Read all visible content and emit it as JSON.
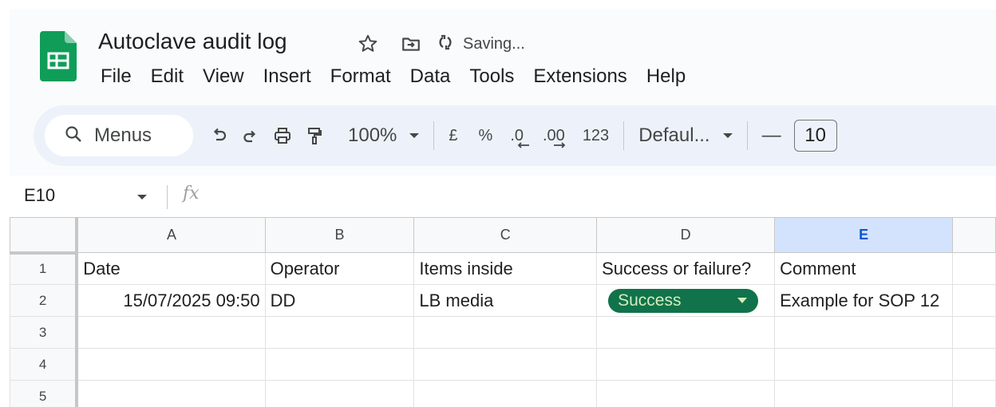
{
  "document": {
    "title": "Autoclave audit log",
    "status": "Saving...",
    "icons": [
      "star-icon",
      "move-to-folder-icon",
      "sync-icon"
    ]
  },
  "menu": [
    "File",
    "Edit",
    "View",
    "Insert",
    "Format",
    "Data",
    "Tools",
    "Extensions",
    "Help"
  ],
  "toolbar": {
    "search_label": "Menus",
    "zoom": "100%",
    "currency": "£",
    "percent": "%",
    "decrease_decimal": ".0",
    "increase_decimal": ".00",
    "number_format": "123",
    "font": "Defaul...",
    "font_size": "10",
    "minus": "—"
  },
  "formula_bar": {
    "cell_ref": "E10",
    "fx_label": "fx",
    "formula": ""
  },
  "sheet": {
    "columns": [
      "A",
      "B",
      "C",
      "D",
      "E"
    ],
    "selected_column": "E",
    "rows": [
      "1",
      "2",
      "3",
      "4",
      "5"
    ],
    "header_row": [
      "Date",
      "Operator",
      "Items inside",
      "Success or failure?",
      "Comment"
    ],
    "data_row": {
      "date": "15/07/2025 09:50",
      "operator": "DD",
      "items": "LB media",
      "status": "Success",
      "comment": "Example for SOP 12"
    }
  },
  "colors": {
    "accent": "#0b57d0",
    "logo_green": "#0f9d58",
    "chip_bg": "#11734b",
    "chip_text": "#d4edbc",
    "toolbar_bg": "#edf2fa"
  }
}
